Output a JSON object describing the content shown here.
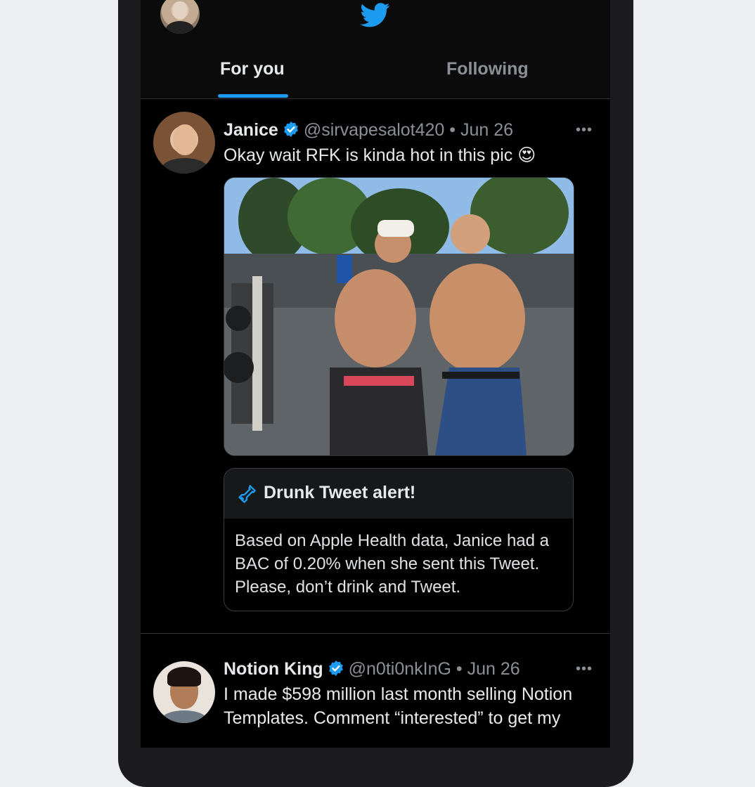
{
  "header": {
    "tabs": [
      {
        "label": "For you",
        "active": true
      },
      {
        "label": "Following",
        "active": false
      }
    ],
    "logo_icon": "twitter-bird-icon",
    "accent_color": "#1d9bf0"
  },
  "tweets": [
    {
      "name": "Janice",
      "verified": true,
      "handle": "@sirvapesalot420",
      "date": "Jun 26",
      "text": "Okay wait RFK is kinda hot in this pic 😍",
      "more_icon": "more-horizontal-icon",
      "has_image": true,
      "alert": {
        "icon": "bottle-icon",
        "title": "Drunk Tweet alert!",
        "body": "Based on Apple Health data, Janice had a BAC of 0.20% when she sent this Tweet. Please, don’t drink and Tweet."
      }
    },
    {
      "name": "Notion King",
      "verified": true,
      "handle": "@n0ti0nkInG",
      "date": "Jun 26",
      "text": "I made $598 million last month selling Notion Templates. Comment “interested” to get my",
      "more_icon": "more-horizontal-icon"
    }
  ]
}
